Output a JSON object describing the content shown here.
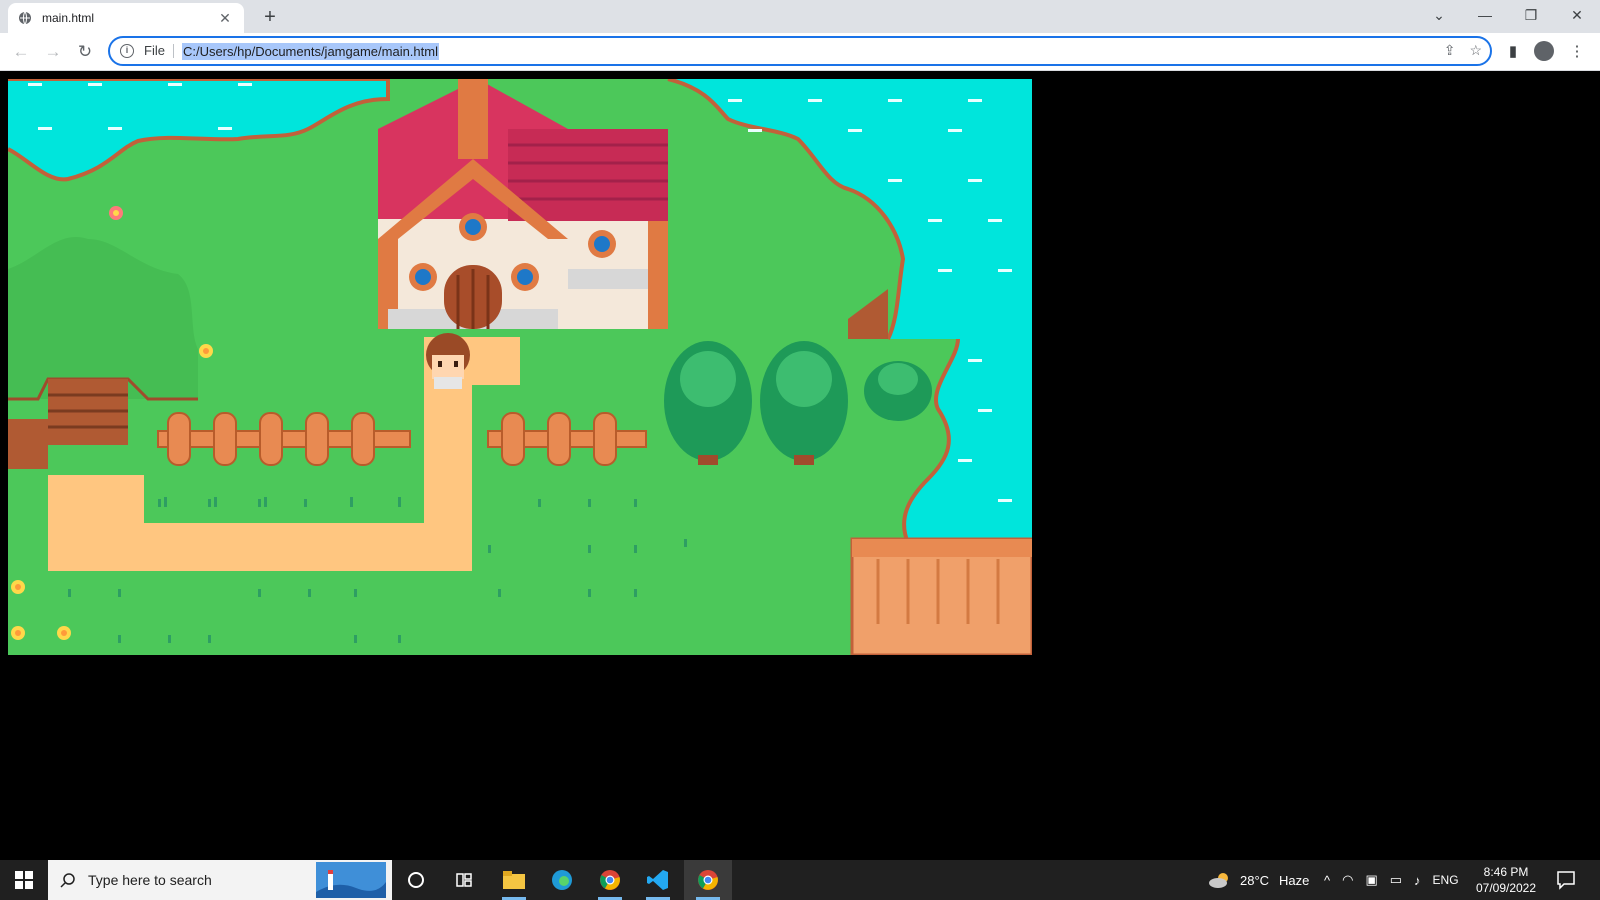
{
  "browser": {
    "tab_title": "main.html",
    "tab_close": "✕",
    "new_tab": "+",
    "omnibox_scheme": "File",
    "omnibox_url": "C:/Users/hp/Documents/jamgame/main.html"
  },
  "game": {
    "title": "",
    "colors": {
      "water": "#00e5dc",
      "grass": "#4cc85a",
      "path": "#ffc680",
      "roof": "#d8345f",
      "wood": "#e07a43"
    }
  },
  "taskbar": {
    "search_placeholder": "Type here to search",
    "weather_temp": "28°C",
    "weather_text": "Haze",
    "language": "ENG",
    "time": "8:46 PM",
    "date": "07/09/2022"
  }
}
